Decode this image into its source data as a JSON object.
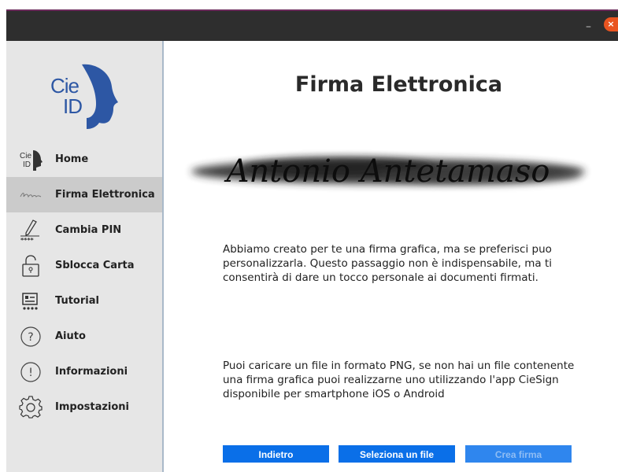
{
  "window": {
    "minimize_glyph": "–",
    "close_glyph": "×"
  },
  "sidebar": {
    "logo": {
      "line1": "Cie",
      "line2": "ID"
    },
    "items": [
      {
        "label": "Home",
        "icon": "cie-card-icon",
        "active": false
      },
      {
        "label": "Firma Elettronica",
        "icon": "signature-icon",
        "active": true
      },
      {
        "label": "Cambia PIN",
        "icon": "pencil-pin-icon",
        "active": false
      },
      {
        "label": "Sblocca Carta",
        "icon": "padlock-icon",
        "active": false
      },
      {
        "label": "Tutorial",
        "icon": "tutorial-icon",
        "active": false
      },
      {
        "label": "Aiuto",
        "icon": "help-icon",
        "active": false
      },
      {
        "label": "Informazioni",
        "icon": "info-icon",
        "active": false
      },
      {
        "label": "Impostazioni",
        "icon": "gear-icon",
        "active": false
      }
    ]
  },
  "main": {
    "title": "Firma Elettronica",
    "signature_text": "Antonio Antetamaso",
    "paragraph1": "Abbiamo creato per te una firma grafica, ma se preferisci puo personalizzarla. Questo passaggio non è indispensabile, ma ti consentirà di dare un tocco personale ai documenti firmati.",
    "paragraph2": "Puoi caricare un file in formato PNG, se non hai un file contenente una firma grafica puoi realizzarne uno utilizzando l'app CieSign disponibile per smartphone iOS o Android",
    "buttons": {
      "back": "Indietro",
      "select_file": "Seleziona un file",
      "create_signature": "Crea firma"
    }
  },
  "colors": {
    "accent": "#0a6fe8",
    "logo_blue": "#2d57a4",
    "sidebar_bg": "#e6e6e6",
    "sidebar_active": "#cbcbcb"
  }
}
